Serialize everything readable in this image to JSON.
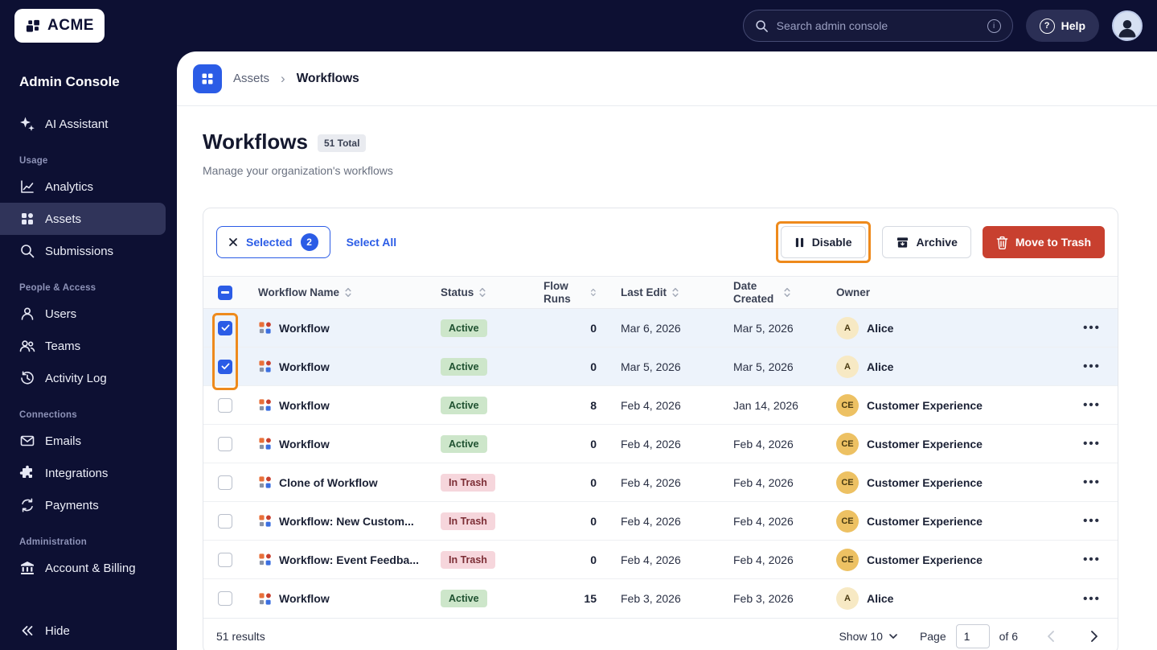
{
  "colors": {
    "navy": "#0D1033",
    "accent": "#2B5CE6",
    "annotation": "#EE8A1C",
    "danger": "#C8402F",
    "active-badge-bg": "#CDE6CA",
    "active-badge-text": "#1F5130",
    "trash-badge-bg": "#F6D6DC",
    "trash-badge-text": "#7C2D35",
    "avatar-a-bg": "#F7E9C4",
    "avatar-ce-bg": "#EDC163",
    "selected-row-bg": "#EDF3FB"
  },
  "topbar": {
    "logo": "ACME",
    "search_placeholder": "Search admin console",
    "help": "Help"
  },
  "sidebar": {
    "title": "Admin Console",
    "ai_label": "AI Assistant",
    "hide_label": "Hide",
    "sections": [
      {
        "heading": "Usage",
        "items": [
          {
            "label": "Analytics"
          },
          {
            "label": "Assets",
            "active": true
          },
          {
            "label": "Submissions"
          }
        ]
      },
      {
        "heading": "People & Access",
        "items": [
          {
            "label": "Users"
          },
          {
            "label": "Teams"
          },
          {
            "label": "Activity Log"
          }
        ]
      },
      {
        "heading": "Connections",
        "items": [
          {
            "label": "Emails"
          },
          {
            "label": "Integrations"
          },
          {
            "label": "Payments"
          }
        ]
      },
      {
        "heading": "Administration",
        "items": [
          {
            "label": "Account & Billing"
          }
        ]
      }
    ]
  },
  "breadcrumb": {
    "section": "Assets",
    "current": "Workflows"
  },
  "page": {
    "title": "Workflows",
    "total_badge": "51 Total",
    "subtitle": "Manage your organization's workflows"
  },
  "toolbar": {
    "selected_label": "Selected",
    "selected_count": "2",
    "select_all": "Select All",
    "disable": "Disable",
    "archive": "Archive",
    "move_to_trash": "Move to Trash"
  },
  "table": {
    "columns": [
      "Workflow Name",
      "Status",
      "Flow Runs",
      "Last Edit",
      "Date Created",
      "Owner"
    ],
    "rows": [
      {
        "checked": true,
        "name": "Workflow",
        "status": "Active",
        "runs": "0",
        "last_edit": "Mar 6, 2026",
        "created": "Mar 5, 2026",
        "owner_initials": "A",
        "owner": "Alice"
      },
      {
        "checked": true,
        "name": "Workflow",
        "status": "Active",
        "runs": "0",
        "last_edit": "Mar 5, 2026",
        "created": "Mar 5, 2026",
        "owner_initials": "A",
        "owner": "Alice"
      },
      {
        "checked": false,
        "name": "Workflow",
        "status": "Active",
        "runs": "8",
        "last_edit": "Feb 4, 2026",
        "created": "Jan 14, 2026",
        "owner_initials": "CE",
        "owner": "Customer Experience"
      },
      {
        "checked": false,
        "name": "Workflow",
        "status": "Active",
        "runs": "0",
        "last_edit": "Feb 4, 2026",
        "created": "Feb 4, 2026",
        "owner_initials": "CE",
        "owner": "Customer Experience"
      },
      {
        "checked": false,
        "name": "Clone of Workflow",
        "status": "In Trash",
        "runs": "0",
        "last_edit": "Feb 4, 2026",
        "created": "Feb 4, 2026",
        "owner_initials": "CE",
        "owner": "Customer Experience"
      },
      {
        "checked": false,
        "name": "Workflow: New Custom...",
        "status": "In Trash",
        "runs": "0",
        "last_edit": "Feb 4, 2026",
        "created": "Feb 4, 2026",
        "owner_initials": "CE",
        "owner": "Customer Experience"
      },
      {
        "checked": false,
        "name": "Workflow: Event Feedba...",
        "status": "In Trash",
        "runs": "0",
        "last_edit": "Feb 4, 2026",
        "created": "Feb 4, 2026",
        "owner_initials": "CE",
        "owner": "Customer Experience"
      },
      {
        "checked": false,
        "name": "Workflow",
        "status": "Active",
        "runs": "15",
        "last_edit": "Feb 3, 2026",
        "created": "Feb 3, 2026",
        "owner_initials": "A",
        "owner": "Alice"
      }
    ]
  },
  "footer": {
    "results": "51 results",
    "show": "Show 10",
    "page_label": "Page",
    "page_value": "1",
    "of_label": "of 6"
  }
}
